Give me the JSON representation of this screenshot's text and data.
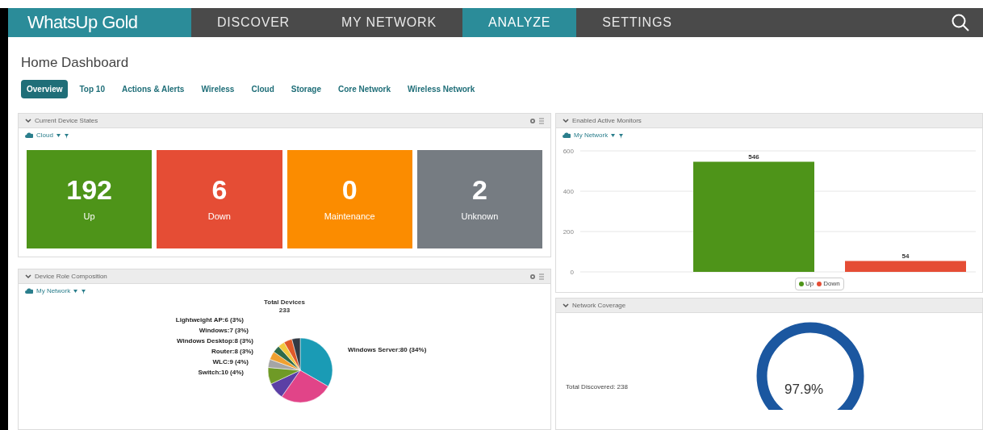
{
  "nav": {
    "logo": "WhatsUp Gold",
    "items": [
      {
        "label": "DISCOVER",
        "selected": false
      },
      {
        "label": "MY NETWORK",
        "selected": false
      },
      {
        "label": "ANALYZE",
        "selected": true
      },
      {
        "label": "SETTINGS",
        "selected": false
      }
    ]
  },
  "page_title": "Home Dashboard",
  "tabs": [
    {
      "label": "Overview",
      "selected": true
    },
    {
      "label": "Top 10",
      "selected": false
    },
    {
      "label": "Actions & Alerts",
      "selected": false
    },
    {
      "label": "Wireless",
      "selected": false
    },
    {
      "label": "Cloud",
      "selected": false
    },
    {
      "label": "Storage",
      "selected": false
    },
    {
      "label": "Core Network",
      "selected": false
    },
    {
      "label": "Wireless Network",
      "selected": false
    }
  ],
  "device_states": {
    "title": "Current Device States",
    "group": "Cloud",
    "tiles": [
      {
        "count": "192",
        "label": "Up",
        "color": "#4e9419"
      },
      {
        "count": "6",
        "label": "Down",
        "color": "#e54d35"
      },
      {
        "count": "0",
        "label": "Maintenance",
        "color": "#fb8c00"
      },
      {
        "count": "2",
        "label": "Unknown",
        "color": "#767c82"
      }
    ]
  },
  "active_monitors": {
    "title": "Enabled Active Monitors",
    "group": "My Network",
    "chart_data": {
      "type": "bar",
      "series": [
        {
          "name": "Up",
          "color": "#4e9419",
          "values": [
            546
          ]
        },
        {
          "name": "Down",
          "color": "#e54d35",
          "values": [
            54
          ]
        }
      ],
      "ylim": [
        0,
        600
      ],
      "yticks": [
        0,
        200,
        400,
        600
      ],
      "data_labels": true
    }
  },
  "role_composition": {
    "title": "Device Role Composition",
    "group": "My Network",
    "total_label": "Total Devices",
    "total": "233",
    "left_labels": [
      "Lightweight AP:6 (3%)",
      "Windows:7 (3%)",
      "Windows Desktop:8 (3%)",
      "Router:8 (3%)",
      "WLC:9 (4%)",
      "Switch:10 (4%)"
    ],
    "right_label": "Windows Server:80 (34%)"
  },
  "coverage": {
    "title": "Network Coverage",
    "total_discovered": "Total Discovered: 238",
    "percent": "97.9%"
  }
}
